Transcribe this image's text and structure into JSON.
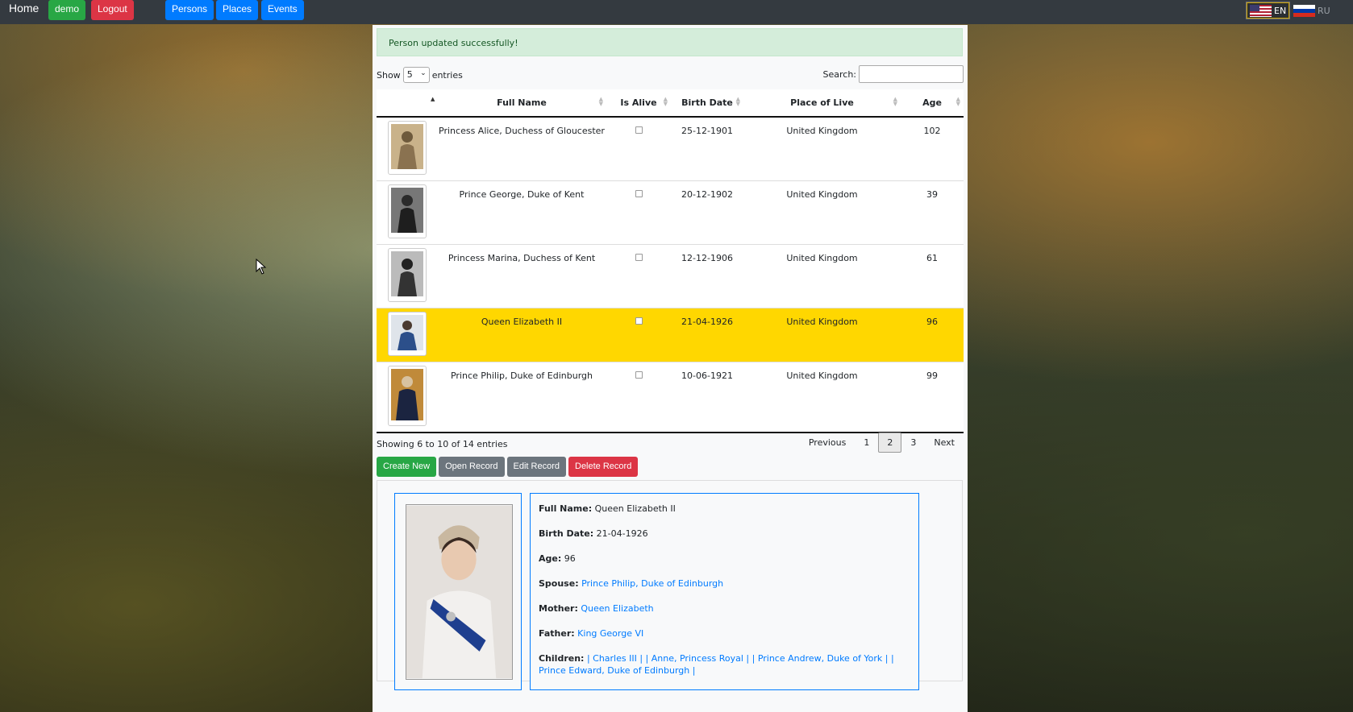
{
  "nav": {
    "home": "Home",
    "user": "demo",
    "logout": "Logout",
    "persons": "Persons",
    "places": "Places",
    "events": "Events",
    "lang_en": "EN",
    "lang_ru": "RU"
  },
  "alert": "Person updated successfully!",
  "controls": {
    "show_label": "Show",
    "page_size": "5",
    "entries_label": "entries",
    "search_label": "Search:"
  },
  "table": {
    "headers": [
      "",
      "Full Name",
      "Is Alive",
      "Birth Date",
      "Place of Live",
      "Age"
    ],
    "rows": [
      {
        "name": "Princess Alice, Duchess of Gloucester",
        "birth": "25-12-1901",
        "place": "United Kingdom",
        "age": "102"
      },
      {
        "name": "Prince George, Duke of Kent",
        "birth": "20-12-1902",
        "place": "United Kingdom",
        "age": "39"
      },
      {
        "name": "Princess Marina, Duchess of Kent",
        "birth": "12-12-1906",
        "place": "United Kingdom",
        "age": "61"
      },
      {
        "name": "Queen Elizabeth II",
        "birth": "21-04-1926",
        "place": "United Kingdom",
        "age": "96"
      },
      {
        "name": "Prince Philip, Duke of Edinburgh",
        "birth": "10-06-1921",
        "place": "United Kingdom",
        "age": "99"
      }
    ]
  },
  "info": "Showing 6 to 10 of 14 entries",
  "pager": {
    "previous": "Previous",
    "p1": "1",
    "p2": "2",
    "p3": "3",
    "next": "Next"
  },
  "actions": {
    "create": "Create New",
    "open": "Open Record",
    "edit": "Edit Record",
    "delete": "Delete Record"
  },
  "detail": {
    "full_name_label": "Full Name:",
    "full_name": "Queen Elizabeth II",
    "birth_label": "Birth Date:",
    "birth": "21-04-1926",
    "age_label": "Age:",
    "age": "96",
    "spouse_label": "Spouse:",
    "spouse": "Prince Philip, Duke of Edinburgh",
    "mother_label": "Mother:",
    "mother": "Queen Elizabeth",
    "father_label": "Father:",
    "father": "King George VI",
    "children_label": "Children:",
    "children": "| Charles III | | Anne, Princess Royal | | Prince Andrew, Duke of York | | Prince Edward, Duke of Edinburgh |"
  },
  "colors": {
    "navbar": "#343a40",
    "success": "#28a745",
    "danger": "#dc3545",
    "primary": "#007bff",
    "secondary": "#6c757d",
    "selected_row": "#ffd700",
    "alert_bg": "#d4edda"
  }
}
